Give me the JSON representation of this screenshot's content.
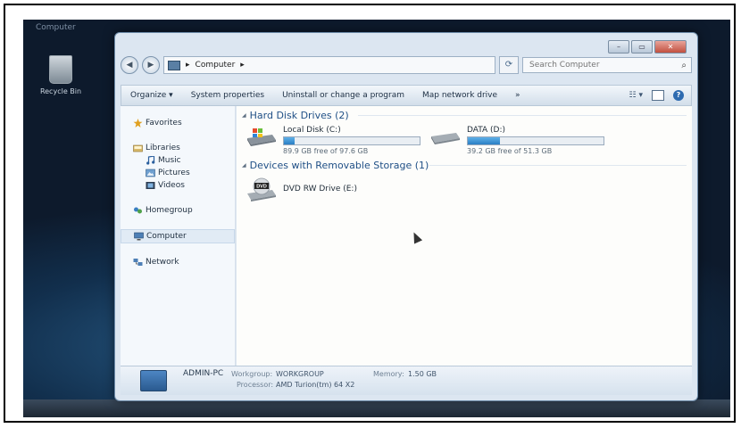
{
  "desktop": {
    "window_caption": "Computer",
    "recycle_bin_label": "Recycle Bin"
  },
  "window": {
    "address": {
      "crumb": "Computer",
      "crumb_sep": "▸"
    },
    "search": {
      "placeholder": "Search Computer"
    },
    "toolbar": {
      "organize": "Organize ▾",
      "system_properties": "System properties",
      "uninstall": "Uninstall or change a program",
      "map_drive": "Map network drive",
      "more": "»"
    },
    "nav": {
      "favorites": "Favorites",
      "libraries": "Libraries",
      "music": "Music",
      "pictures": "Pictures",
      "videos": "Videos",
      "homegroup": "Homegroup",
      "computer": "Computer",
      "network": "Network"
    },
    "groups": {
      "hdd": "Hard Disk Drives (2)",
      "removable": "Devices with Removable Storage (1)"
    },
    "drives": [
      {
        "name": "Local Disk (C:)",
        "free": "89.9 GB free of 97.6 GB",
        "used_fraction": 0.079
      },
      {
        "name": "DATA (D:)",
        "free": "39.2 GB free of 51.3 GB",
        "used_fraction": 0.236
      }
    ],
    "dvd": {
      "name": "DVD RW Drive (E:)",
      "badge": "DVD"
    },
    "details": {
      "pc_name": "ADMIN-PC",
      "workgroup_label": "Workgroup:",
      "workgroup": "WORKGROUP",
      "memory_label": "Memory:",
      "memory": "1.50 GB",
      "processor_label": "Processor:",
      "processor": "AMD Turion(tm) 64 X2"
    },
    "colors": {
      "accent": "#1f4f86",
      "bar_fill": "#2a7fc4"
    }
  }
}
